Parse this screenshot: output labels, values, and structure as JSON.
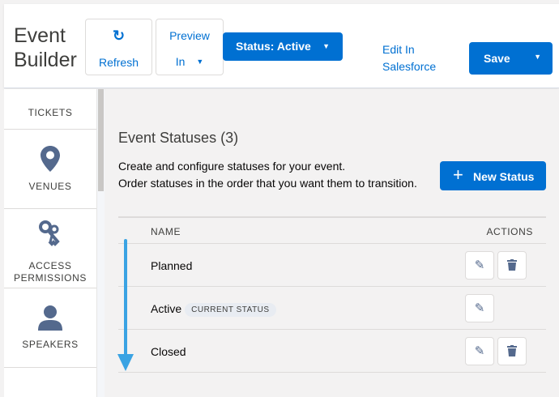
{
  "header": {
    "title_line1": "Event",
    "title_line2": "Builder",
    "refresh_icon": "refresh-icon",
    "refresh_label": "Refresh",
    "preview_line1": "Preview",
    "preview_line2": "In",
    "status_label": "Status:  Active",
    "edit_line1": "Edit In",
    "edit_line2": "Salesforce",
    "save_label": "Save"
  },
  "sidebar": {
    "items": [
      {
        "label": "TICKETS"
      },
      {
        "label": "VENUES",
        "icon": "location-pin-icon"
      },
      {
        "label_line1": "ACCESS",
        "label_line2": "PERMISSIONS",
        "icon": "keys-icon"
      },
      {
        "label": "SPEAKERS",
        "icon": "user-icon"
      },
      {
        "icon": "list-icon"
      }
    ]
  },
  "main": {
    "section_title": "Event Statuses (3)",
    "desc_line1": "Create and configure statuses for your event.",
    "desc_line2": "Order statuses in the order that you want them to transition.",
    "new_status_label": "New Status",
    "columns": {
      "name": "NAME",
      "actions": "ACTIONS"
    },
    "rows": [
      {
        "name": "Planned",
        "badge": "",
        "actions": [
          "edit",
          "delete"
        ]
      },
      {
        "name": "Active",
        "badge": "CURRENT STATUS",
        "actions": [
          "edit"
        ]
      },
      {
        "name": "Closed",
        "badge": "",
        "actions": [
          "edit",
          "delete"
        ]
      }
    ]
  },
  "colors": {
    "brand": "#0070d2",
    "drag_arrow": "#3aa3e3",
    "icon_gray": "#54698d"
  }
}
